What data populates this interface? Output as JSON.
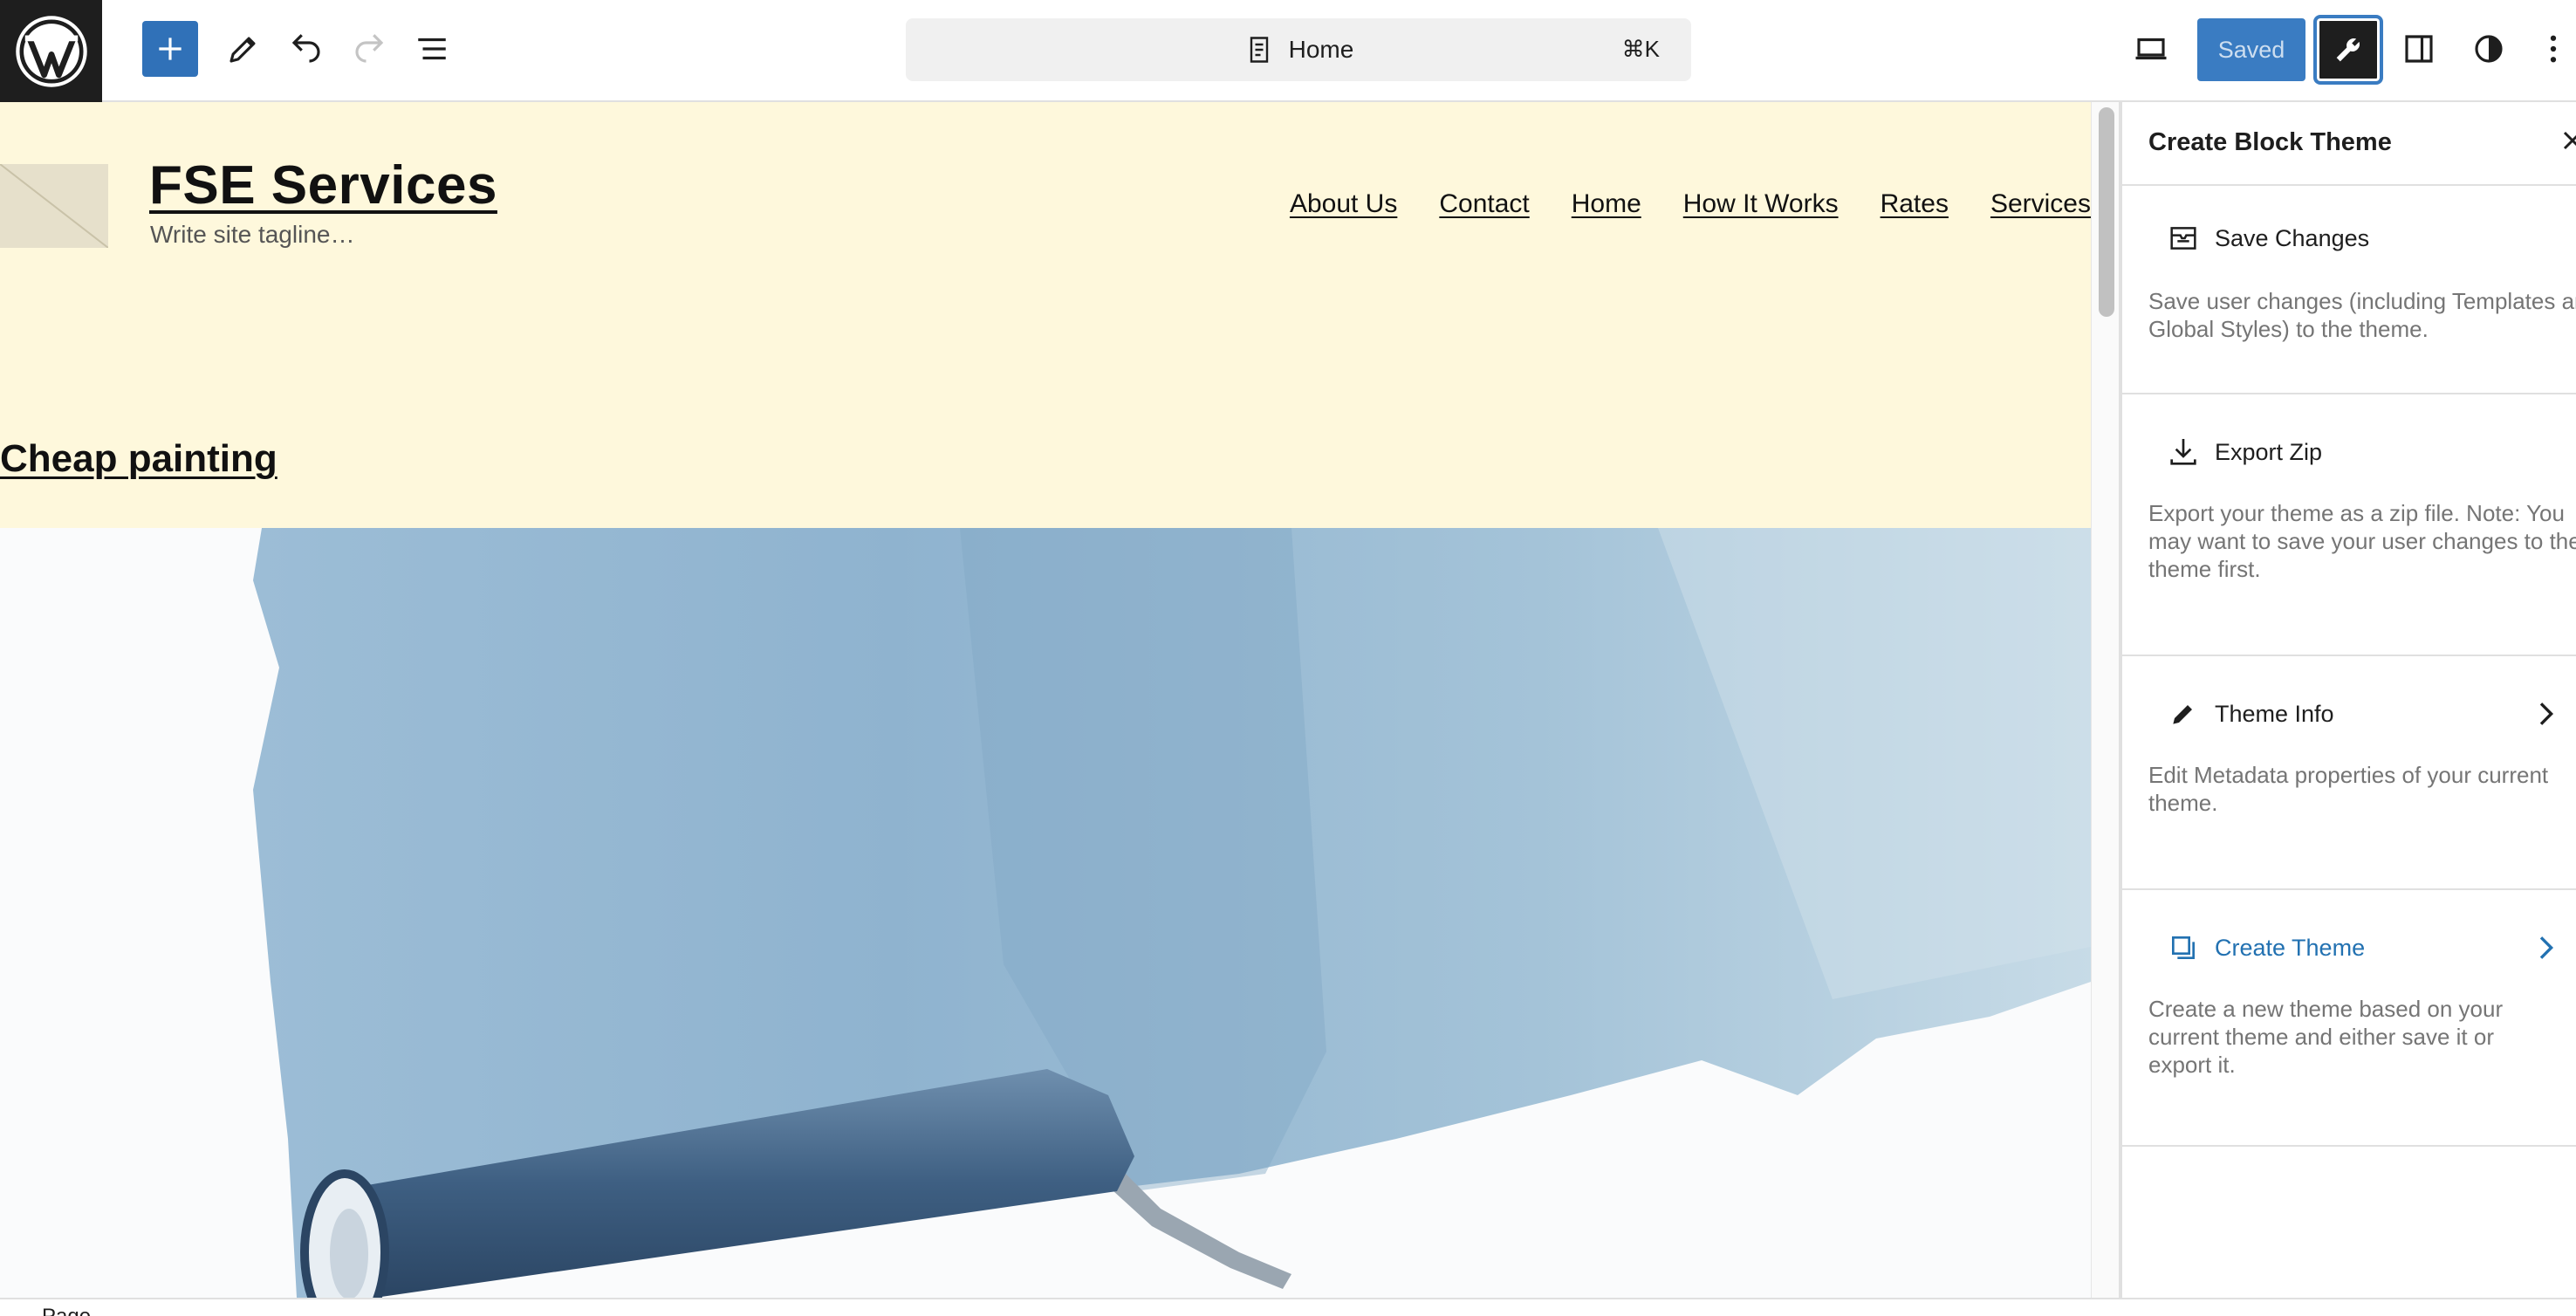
{
  "toolbar": {
    "document_title": "Home",
    "shortcut": "⌘K",
    "saved_label": "Saved",
    "icons": [
      "wordpress-logo",
      "add-block",
      "pencil-tools",
      "undo",
      "redo",
      "list-view",
      "document",
      "desktop-preview",
      "wrench",
      "sidebar-toggle",
      "styles-contrast",
      "more-vertical"
    ]
  },
  "site": {
    "title": "FSE Services",
    "tagline": "Write site tagline…",
    "nav": [
      "About Us",
      "Contact",
      "Home",
      "How It Works",
      "Rates",
      "Services"
    ],
    "post_title": "Cheap painting",
    "header_bg": "#fef8dc"
  },
  "sidebar": {
    "title": "Create Block Theme",
    "items": [
      {
        "label": "Save Changes",
        "description": "Save user changes (including Templates and Global Styles) to the theme."
      },
      {
        "label": "Export Zip",
        "description": "Export your theme as a zip file. Note: You may want to save your user changes to the theme first."
      },
      {
        "label": "Theme Info",
        "description": "Edit Metadata properties of your current theme."
      },
      {
        "label": "Create Theme",
        "description": "Create a new theme based on your current theme and either save it or export it."
      }
    ]
  },
  "status": {
    "breadcrumb": "Page"
  },
  "colors": {
    "accent": "#3071b8",
    "link_blue": "#2271b1",
    "dark": "#1e1e1e"
  }
}
